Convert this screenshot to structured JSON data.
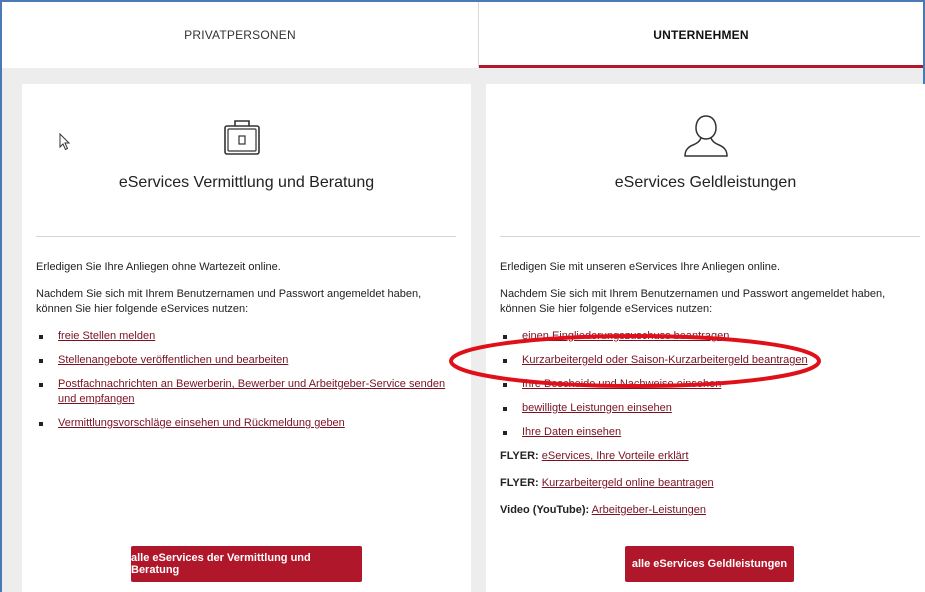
{
  "tabs": {
    "private": "PRIVATPERSONEN",
    "company": "UNTERNEHMEN"
  },
  "left_card": {
    "icon": "briefcase-icon",
    "title": "eServices Vermittlung und Beratung",
    "intro": "Erledigen Sie Ihre Anliegen ohne Wartezeit online.",
    "login_note": "Nachdem Sie sich mit Ihrem Benutzernamen und Passwort angemeldet haben, können Sie hier folgende eServices nutzen:",
    "links": [
      "freie Stellen melden",
      "Stellenangebote veröffentlichen und bearbeiten",
      "Postfachnachrichten an Bewerberin, Bewerber und Arbeitgeber-Service senden und empfangen",
      "Vermittlungsvorschläge einsehen und Rückmeldung geben"
    ],
    "button": "alle eServices der Vermittlung und Beratung"
  },
  "right_card": {
    "icon": "person-icon",
    "title": "eServices Geldleistungen",
    "intro": "Erledigen Sie mit unseren eServices Ihre Anliegen online.",
    "login_note": "Nachdem Sie sich mit Ihrem Benutzernamen und Passwort angemeldet haben, können Sie hier folgende eServices nutzen:",
    "links": [
      "einen Eingliederungszuschuss beantragen",
      "Kurzarbeitergeld oder Saison-Kurzarbeitergeld beantragen",
      "Ihre Bescheide und Nachweise einsehen",
      "bewilligte Leistungen einsehen",
      "Ihre Daten einsehen"
    ],
    "flyer1_label": "FLYER:",
    "flyer1_link": "eServices, Ihre Vorteile erklärt",
    "flyer2_label": "FLYER:",
    "flyer2_link": "Kurzarbeitergeld online beantragen",
    "video_label": "Video (YouTube):",
    "video_link": "Arbeitgeber-Leistungen",
    "button": "alle eServices Geldleistungen"
  },
  "colors": {
    "accent": "#b0172a",
    "link": "#7a1222",
    "annotation": "#e0101a"
  }
}
